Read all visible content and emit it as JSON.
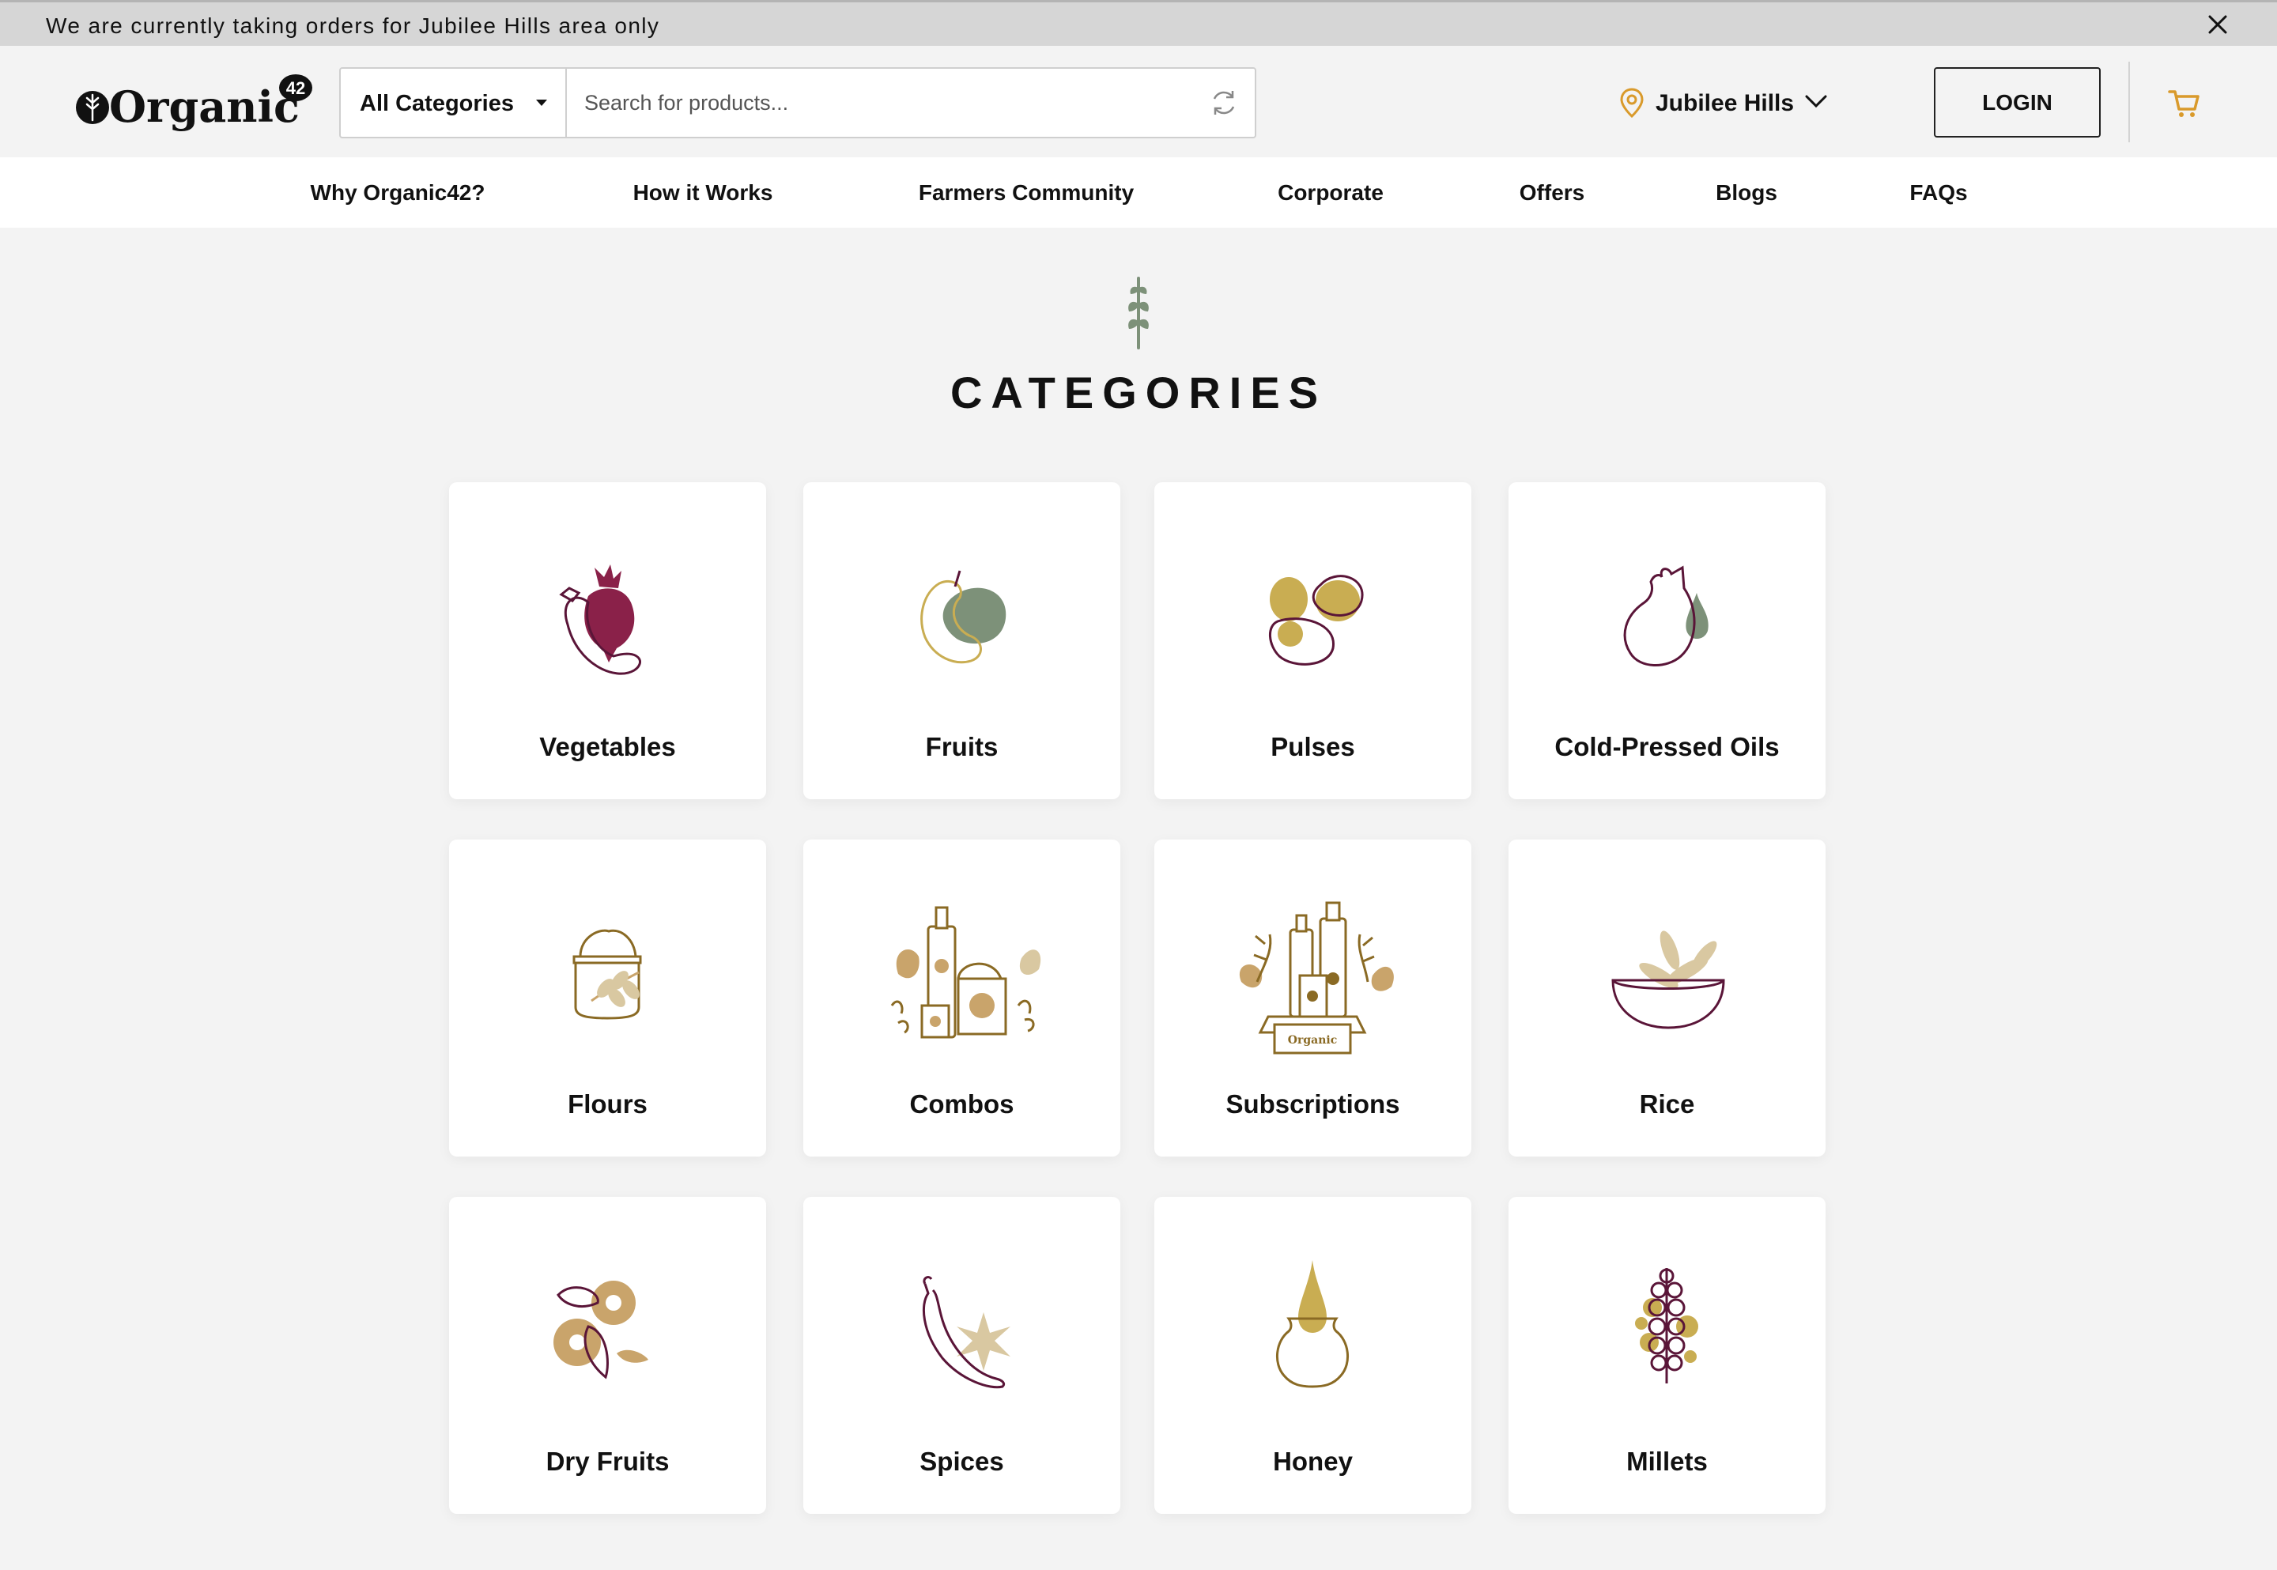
{
  "announcement": {
    "text": "We are currently taking orders for Jubilee Hills area only"
  },
  "header": {
    "logo_text": "Organic",
    "logo_badge": "42",
    "category_select": "All Categories",
    "search_placeholder": "Search for products...",
    "location": "Jubilee Hills",
    "login_label": "LOGIN"
  },
  "nav": [
    "Why Organic42?",
    "How it Works",
    "Farmers Community",
    "Corporate",
    "Offers",
    "Blogs",
    "FAQs"
  ],
  "main": {
    "title": "CATEGORIES",
    "categories": [
      {
        "label": "Vegetables",
        "icon": "beetroot-icon"
      },
      {
        "label": "Fruits",
        "icon": "fruit-icon"
      },
      {
        "label": "Pulses",
        "icon": "beans-icon"
      },
      {
        "label": "Cold-Pressed Oils",
        "icon": "oil-jug-icon"
      },
      {
        "label": "Flours",
        "icon": "flour-sack-icon"
      },
      {
        "label": "Combos",
        "icon": "combo-products-icon"
      },
      {
        "label": "Subscriptions",
        "icon": "subscription-box-icon"
      },
      {
        "label": "Rice",
        "icon": "rice-bowl-icon"
      },
      {
        "label": "Dry Fruits",
        "icon": "dry-fruits-icon"
      },
      {
        "label": "Spices",
        "icon": "chili-star-anise-icon"
      },
      {
        "label": "Honey",
        "icon": "honey-pot-icon"
      },
      {
        "label": "Millets",
        "icon": "millet-stalk-icon"
      }
    ]
  },
  "colors": {
    "accent": "#d99a2b",
    "plum": "#5a1538",
    "beet": "#8a2149",
    "sage": "#7d9179",
    "mustard": "#c9ad52",
    "tan": "#c9a46b",
    "brown": "#8a6a24"
  }
}
